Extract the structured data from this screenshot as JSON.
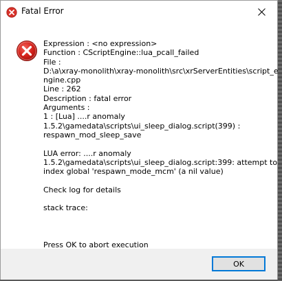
{
  "window": {
    "title": "Fatal Error",
    "title_icon": "error-icon",
    "close_icon": "close-icon"
  },
  "message": {
    "icon": "error-icon",
    "lines": [
      "Expression    : <no expression>",
      "Function      : CScriptEngine::lua_pcall_failed",
      "File          :",
      "D:\\a\\xray-monolith\\xray-monolith\\src\\xrServerEntities\\script_e",
      "ngine.cpp",
      "Line          : 262",
      "Description   : fatal error",
      "Arguments     :",
      " 1 : [Lua] ....r anomaly",
      "1.5.2\\gamedata\\scripts\\ui_sleep_dialog.script(399) :",
      "respawn_mod_sleep_save",
      "",
      "LUA error: ....r anomaly",
      "1.5.2\\gamedata\\scripts\\ui_sleep_dialog.script:399: attempt to",
      "index global 'respawn_mode_mcm' (a nil value)",
      "",
      "Check log for details",
      "",
      "stack trace:",
      "",
      "",
      "",
      "Press OK to abort execution"
    ]
  },
  "footer": {
    "ok_label": "OK"
  },
  "colors": {
    "error_red": "#e81123",
    "focus_blue": "#0078d7",
    "footer_bg": "#f0f0f0"
  }
}
